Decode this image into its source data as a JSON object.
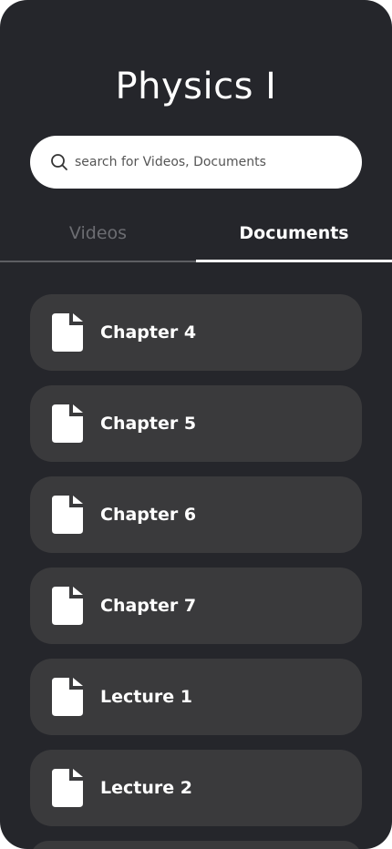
{
  "header": {
    "title": "Physics I"
  },
  "search": {
    "placeholder": "search for Videos, Documents",
    "value": "",
    "icon": "search-icon"
  },
  "tabs": [
    {
      "label": "Videos",
      "active": false
    },
    {
      "label": "Documents",
      "active": true
    }
  ],
  "documents": [
    {
      "label": "Chapter 4",
      "icon": "document-icon"
    },
    {
      "label": "Chapter 5",
      "icon": "document-icon"
    },
    {
      "label": "Chapter 6",
      "icon": "document-icon"
    },
    {
      "label": "Chapter 7",
      "icon": "document-icon"
    },
    {
      "label": "Lecture 1",
      "icon": "document-icon"
    },
    {
      "label": "Lecture 2",
      "icon": "document-icon"
    }
  ],
  "colors": {
    "background": "#25262b",
    "card": "#3a3a3c",
    "text": "#ffffff",
    "inactive_tab": "#6c6d72",
    "search_bg": "#ffffff"
  }
}
